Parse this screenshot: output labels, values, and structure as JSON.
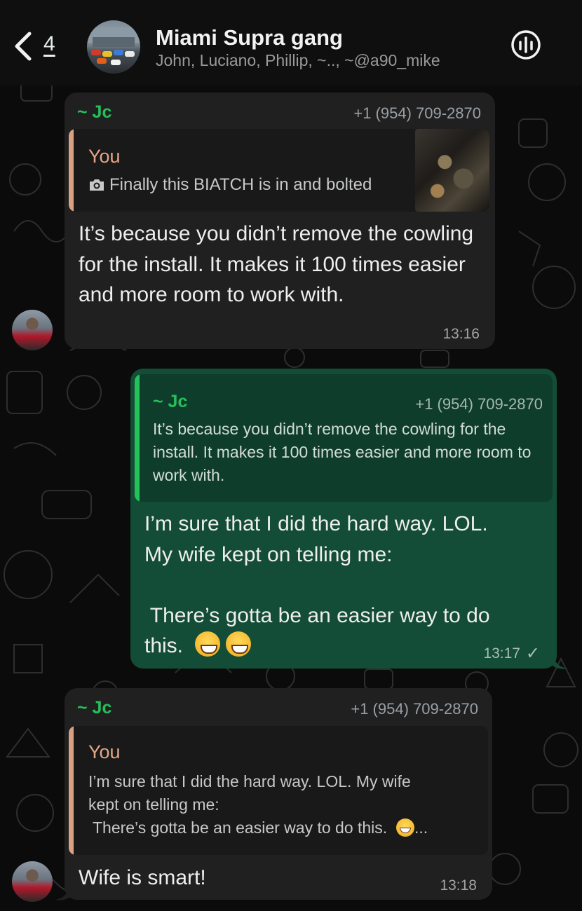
{
  "header": {
    "back_count": "4",
    "title": "Miami Supra gang",
    "members": "John, Luciano, Phillip, ~.., ~@a90_mike"
  },
  "messages": [
    {
      "sender": "~ Jc",
      "phone": "+1 (954) 709-2870",
      "quote_author": "You",
      "quote_text": "Finally this BIATCH is in and bolted",
      "text": "It’s because you didn’t remove the cowling for the install. It makes it 100 times easier and more room to work with.",
      "time": "13:16"
    },
    {
      "quote_author": "~ Jc",
      "quote_phone": "+1 (954) 709-2870",
      "quote_text": "It’s because you didn’t remove the cowling for the install. It makes it 100 times easier and more room to work with.",
      "text_line1": "I’m sure that I did the hard way.  LOL.",
      "text_line2": "My wife kept on telling me:",
      "text_line3": " There’s gotta be an easier way to do",
      "text_line4": "this.",
      "time": "13:17",
      "status": "✓"
    },
    {
      "sender": "~ Jc",
      "phone": "+1 (954) 709-2870",
      "quote_author": "You",
      "quote_text_line1": "I’m sure that I did the hard way.  LOL.  My wife",
      "quote_text_line2": "kept on telling me:",
      "quote_text_line3": " There’s gotta be an easier way to do this.",
      "quote_ellipsis": "...",
      "text": "Wife is smart!",
      "time": "13:18"
    }
  ],
  "colors": {
    "sender_name": "#25c05a",
    "outgoing_bubble": "#144d37",
    "incoming_bubble": "#202020",
    "quote_bar_you": "#d9a184",
    "quote_bar_jc": "#25c05a"
  }
}
